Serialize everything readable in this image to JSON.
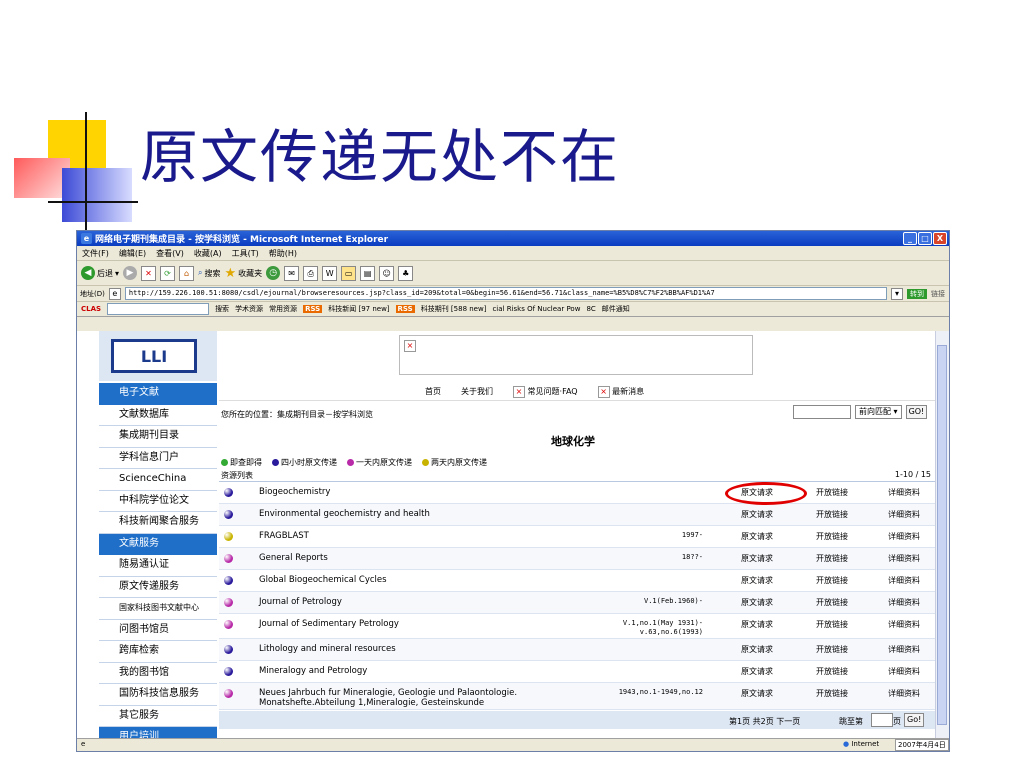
{
  "slide": {
    "title": "原文传递无处不在"
  },
  "window": {
    "title": "网络电子期刊集成目录 - 按学科浏览 - Microsoft Internet Explorer",
    "buttons": [
      "_",
      "□",
      "X"
    ]
  },
  "menu": [
    "文件(F)",
    "编辑(E)",
    "查看(V)",
    "收藏(A)",
    "工具(T)",
    "帮助(H)"
  ],
  "toolbar": {
    "back": "后退",
    "search": "搜索",
    "favorites": "收藏夹"
  },
  "address": {
    "label": "地址(D)",
    "url": "http://159.226.100.51:8080/csdl/ejournal/browseresources.jsp?class_id=209&total=0&begin=56.61&end=56.71&class_name=%B5%D8%C7%F2%BB%AF%D1%A7",
    "go": "转到",
    "links": "链接"
  },
  "linkbar": {
    "clas": "CLAS",
    "search": "搜索",
    "academic": "学术资源",
    "common": "常用资源",
    "rss": "RSS",
    "news": "科技新闻 [97 new]",
    "journal": "科技期刊 [588 new]",
    "ticker": "cial Risks Of Nuclear Pow",
    "temp": "8C",
    "mail": "邮件通知"
  },
  "logo": {
    "text": "LLI"
  },
  "leftnav": [
    "电子文献",
    "文献数据库",
    "集成期刊目录",
    "学科信息门户",
    "ScienceChina",
    "中科院学位论文",
    "科技新闻聚合服务",
    "文献服务",
    "随易通认证",
    "原文传递服务",
    "国家科技图书文献中心",
    "问图书馆员",
    "跨库检索",
    "我的图书馆",
    "国防科技信息服务",
    "其它服务",
    "用户培训"
  ],
  "topnav": {
    "home": "首页",
    "about": "关于我们",
    "faq": "常见问题·FAQ",
    "news": "最新消息"
  },
  "breadcrumb": "您所在的位置：集成期刊目录－按学科浏览",
  "search": {
    "match": "前向匹配",
    "go": "GO!"
  },
  "subject": "地球化学",
  "legend": [
    {
      "label": "即查即得",
      "color": "#33aa33"
    },
    {
      "label": "四小时原文传递",
      "color": "#2a1a9c"
    },
    {
      "label": "一天内原文传递",
      "color": "#b82aa8"
    },
    {
      "label": "两天内原文传递",
      "color": "#c8b400"
    }
  ],
  "list": {
    "heading": "资源列表",
    "range": "1-10 / 15",
    "request_label": "原文请求",
    "open_label": "开放链接",
    "detail_label": "详细资料",
    "rows": [
      {
        "title": "Biogeochemistry",
        "coverage": "",
        "color": "#2a1a9c"
      },
      {
        "title": "Environmental geochemistry and health",
        "coverage": "",
        "color": "#2a1a9c"
      },
      {
        "title": "FRAGBLAST",
        "coverage": "1997-",
        "color": "#c8b400"
      },
      {
        "title": "General Reports",
        "coverage": "18??-",
        "color": "#b82aa8"
      },
      {
        "title": "Global Biogeochemical Cycles",
        "coverage": "",
        "color": "#2a1a9c"
      },
      {
        "title": "Journal of Petrology",
        "coverage": "V.1(Feb.1960)-",
        "color": "#b82aa8"
      },
      {
        "title": "Journal of Sedimentary Petrology",
        "coverage": "V.1,no.1(May 1931)-\nv.63,no.6(1993)",
        "color": "#b82aa8"
      },
      {
        "title": "Lithology and mineral resources",
        "coverage": "",
        "color": "#2a1a9c"
      },
      {
        "title": "Mineralogy and Petrology",
        "coverage": "",
        "color": "#2a1a9c"
      },
      {
        "title": "Neues Jahrbuch fur Mineralogie, Geologie und Palaontologie.\nMonatshefte.Abteilung 1,Mineralogie, Gesteinskunde",
        "coverage": "1943,no.1-1949,no.12",
        "color": "#b82aa8"
      }
    ]
  },
  "pager": {
    "text": "第1页 共2页 下一页",
    "jump": "跳至第",
    "page": "页",
    "go": "Go!"
  },
  "status": {
    "zone": "Internet",
    "date": "2007年4月4日"
  }
}
